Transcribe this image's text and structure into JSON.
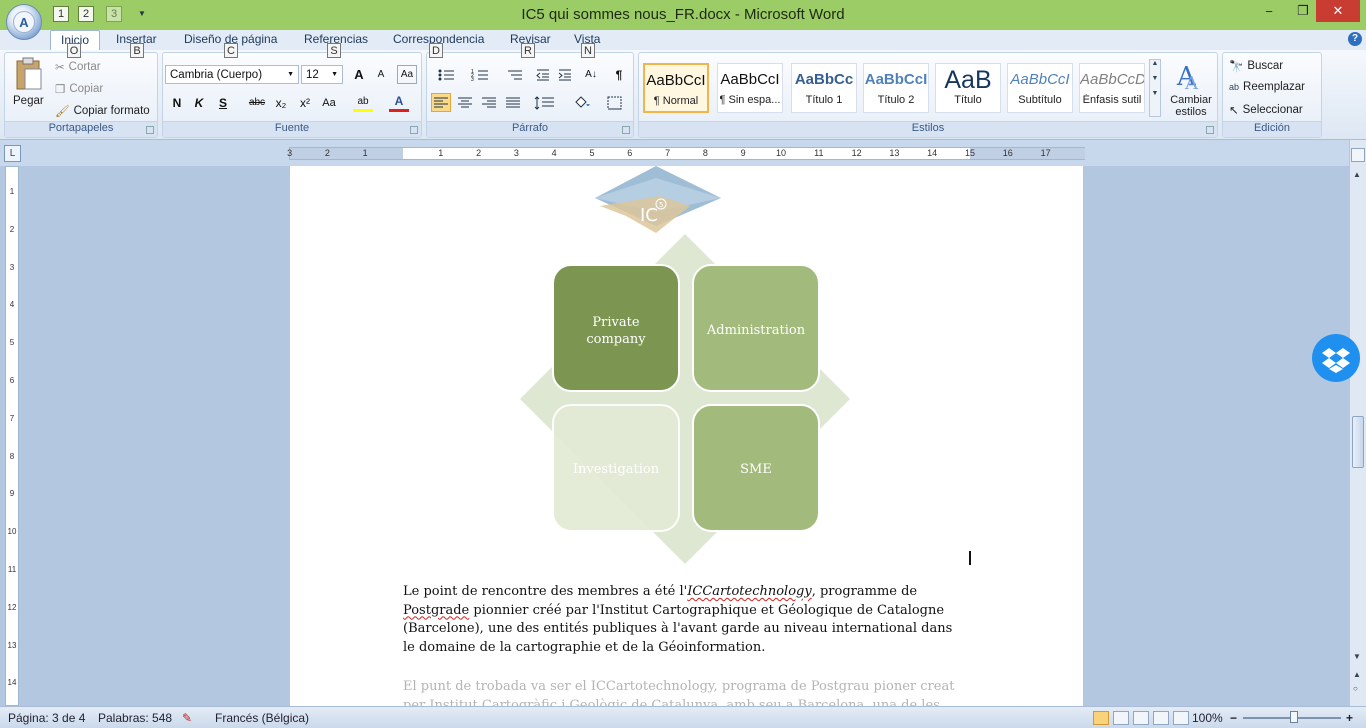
{
  "titlebar": {
    "title": "IC5 qui sommes nous_FR.docx - Microsoft Word",
    "orb_key": "A",
    "qat_keys": [
      "1",
      "2",
      "3"
    ],
    "minimize": "−",
    "restore": "❐",
    "close": "✕"
  },
  "tabs": [
    {
      "label": "Inicio",
      "key": "O"
    },
    {
      "label": "Insertar",
      "key": "B"
    },
    {
      "label": "Diseño de página",
      "key": "C"
    },
    {
      "label": "Referencias",
      "key": "S"
    },
    {
      "label": "Correspondencia",
      "key": "D"
    },
    {
      "label": "Revisar",
      "key": "R"
    },
    {
      "label": "Vista",
      "key": "N"
    }
  ],
  "help": "?",
  "clipboard": {
    "group": "Portapapeles",
    "paste": "Pegar",
    "cut": "Cortar",
    "copy": "Copiar",
    "format_painter": "Copiar formato"
  },
  "font": {
    "group": "Fuente",
    "family": "Cambria (Cuerpo)",
    "size": "12",
    "grow": "A",
    "shrink": "A",
    "clear_format": "Aa",
    "bold": "N",
    "italic": "K",
    "underline": "S",
    "strike": "abc",
    "subscript": "x₂",
    "superscript": "x²",
    "change_case": "Aa",
    "highlight": "ab",
    "font_color": "A"
  },
  "paragraph": {
    "group": "Párrafo",
    "pilcrow": "¶",
    "sort": "A↓"
  },
  "styles": {
    "group": "Estilos",
    "items": [
      {
        "preview": "AaBbCcI",
        "name": "¶ Normal"
      },
      {
        "preview": "AaBbCcI",
        "name": "¶ Sin espa..."
      },
      {
        "preview": "AaBbCc",
        "name": "Título 1"
      },
      {
        "preview": "AaBbCcI",
        "name": "Título 2"
      },
      {
        "preview": "AaB",
        "name": "Título"
      },
      {
        "preview": "AaBbCcI",
        "name": "Subtítulo"
      },
      {
        "preview": "AaBbCcD",
        "name": "Énfasis sutil"
      }
    ],
    "change_styles_1": "Cambiar",
    "change_styles_2": "estilos"
  },
  "editing": {
    "group": "Edición",
    "find": "Buscar",
    "replace": "Reemplazar",
    "select": "Seleccionar"
  },
  "ruler": {
    "corner": "L",
    "numbers": [
      "3",
      "2",
      "1",
      "1",
      "2",
      "3",
      "4",
      "5",
      "6",
      "7",
      "8",
      "9",
      "10",
      "11",
      "12",
      "13",
      "14",
      "15",
      "16",
      "17"
    ],
    "vnumbers": [
      "1",
      "2",
      "3",
      "4",
      "5",
      "6",
      "7",
      "8",
      "9",
      "10",
      "11",
      "12",
      "13",
      "14"
    ]
  },
  "document": {
    "logo_text": "IC",
    "logo_sup": "5",
    "diagram": {
      "cells": [
        "Private company",
        "Administration",
        "Investigation",
        "SME"
      ],
      "colors": {
        "dark": "#7c9652",
        "mid": "#a2ba7c",
        "light": "#e3ebd6",
        "diamond": "#d9e4cc"
      }
    },
    "para1": {
      "t1": "Le point de rencontre des membres a été l'",
      "t2": "ICCartotechnology",
      "t3": ", programme de",
      "t4": "Postgrade",
      "t5": " pionnier créé par l'Institut Cartographique et Géologique de Catalogne (Barcelone), une des entités publiques à l'avant garde au niveau international dans le domaine de la cartographie et de la Géoinformation."
    },
    "para2": {
      "line1": "El punt de trobada va ser el ICCartotechnology, programa de Postgrau pioner creat",
      "line2": "per Institut Cartogràfic i Geològic de Catalunya, amb seu a Barcelona, una de les"
    }
  },
  "statusbar": {
    "page": "Página: 3 de 4",
    "words": "Palabras: 548",
    "language": "Francés (Bélgica)",
    "zoom": "100%",
    "zoom_minus": "−",
    "zoom_plus": "+"
  },
  "colors": {
    "titlebar": "#9ccc65",
    "accent": "#2f6fc0",
    "dropbox": "#1f8ff0"
  }
}
